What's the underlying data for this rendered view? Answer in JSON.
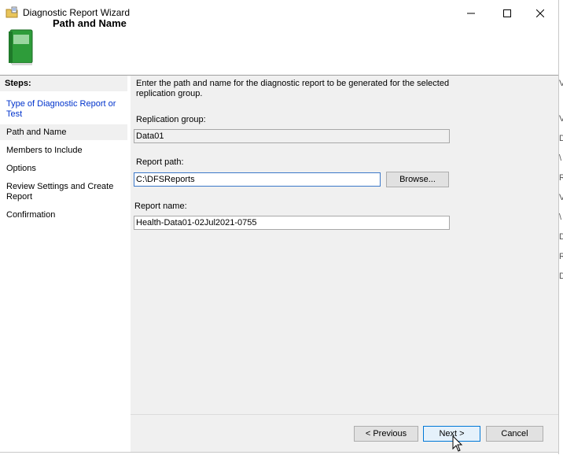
{
  "window": {
    "title": "Diagnostic Report Wizard"
  },
  "header": {
    "page_title": "Path and Name"
  },
  "steps": {
    "label": "Steps:",
    "items": [
      {
        "label": "Type of Diagnostic Report or Test"
      },
      {
        "label": "Path and Name"
      },
      {
        "label": "Members to Include"
      },
      {
        "label": "Options"
      },
      {
        "label": "Review Settings and Create Report"
      },
      {
        "label": "Confirmation"
      }
    ]
  },
  "main": {
    "intro": "Enter the path and name for the diagnostic report to be generated for the selected replication group.",
    "replication_group": {
      "label": "Replication group:",
      "value": "Data01"
    },
    "report_path": {
      "label": "Report path:",
      "value": "C:\\DFSReports",
      "browse_label": "Browse..."
    },
    "report_name": {
      "label": "Report name:",
      "value": "Health-Data01-02Jul2021-0755"
    }
  },
  "footer": {
    "previous_label": "< Previous",
    "next_label": "Next >",
    "cancel_label": "Cancel"
  },
  "background_edge": {
    "glyphs": [
      "V",
      "V",
      "D",
      "\\",
      "R",
      "V",
      "\\",
      "D",
      "R",
      "D"
    ]
  }
}
